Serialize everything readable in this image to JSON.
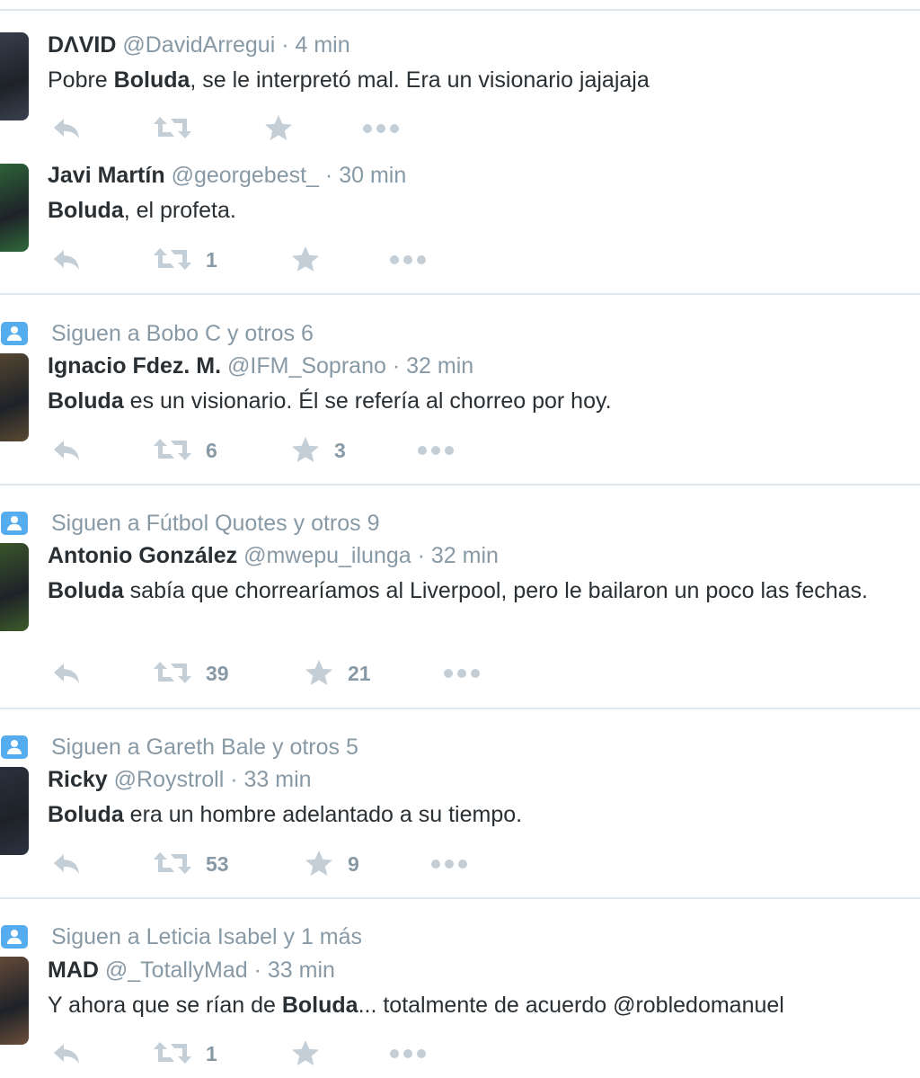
{
  "tweets": [
    {
      "social": null,
      "name": "DΛVID",
      "handle": "@DavidArregui",
      "dot": "·",
      "time": "4 min",
      "text": [
        {
          "t": "Pobre "
        },
        {
          "t": "Boluda",
          "b": true
        },
        {
          "t": ", se le interpretó mal. Era un visionario jajajaja"
        }
      ],
      "retweets": "",
      "favorites": "",
      "avatar_color": "#3a4150"
    },
    {
      "social": null,
      "name": "Javi Martín",
      "handle": "@georgebest_",
      "dot": "·",
      "time": "30 min",
      "text": [
        {
          "t": "Boluda",
          "b": true
        },
        {
          "t": ", el profeta."
        }
      ],
      "retweets": "1",
      "favorites": "",
      "avatar_color": "#2f6a3a"
    },
    {
      "social": "Siguen a Bobo C y otros 6",
      "name": "Ignacio Fdez. M.",
      "handle": "@IFM_Soprano",
      "dot": "·",
      "time": "32 min",
      "text": [
        {
          "t": "Boluda",
          "b": true
        },
        {
          "t": " es un visionario. Él se refería al chorreo por hoy."
        }
      ],
      "retweets": "6",
      "favorites": "3",
      "avatar_color": "#5a4a32"
    },
    {
      "social": "Siguen a Fútbol Quotes y otros 9",
      "name": "Antonio González",
      "handle": "@mwepu_ilunga",
      "dot": "·",
      "time": "32 min",
      "text": [
        {
          "t": "Boluda",
          "b": true
        },
        {
          "t": " sabía que chorrearíamos al Liverpool, pero le bailaron un poco las fechas."
        }
      ],
      "retweets": "39",
      "favorites": "21",
      "avatar_color": "#3d5c2a"
    },
    {
      "social": "Siguen a Gareth Bale y otros 5",
      "name": "Ricky",
      "handle": "@Roystroll",
      "dot": "·",
      "time": "33 min",
      "text": [
        {
          "t": "Boluda",
          "b": true
        },
        {
          "t": " era un hombre adelantado a su tiempo."
        }
      ],
      "retweets": "53",
      "favorites": "9",
      "avatar_color": "#2b3340"
    },
    {
      "social": "Siguen a Leticia Isabel y 1 más",
      "name": "MAD",
      "handle": "@_TotallyMad",
      "dot": "·",
      "time": "33 min",
      "text": [
        {
          "t": "Y ahora que se rían de "
        },
        {
          "t": "Boluda",
          "b": true
        },
        {
          "t": "... totalmente de acuerdo @robledomanuel"
        }
      ],
      "retweets": "1",
      "favorites": "",
      "avatar_color": "#6b4e3a"
    }
  ],
  "colors": {
    "text": "#292f33",
    "muted": "#8899a6",
    "icon": "#c4ced6",
    "social_badge": "#55acee",
    "divider": "#e1e8ed"
  },
  "icons": {
    "reply": "reply-icon",
    "retweet": "retweet-icon",
    "favorite": "star-icon",
    "more": "more-icon",
    "social": "person-icon"
  }
}
